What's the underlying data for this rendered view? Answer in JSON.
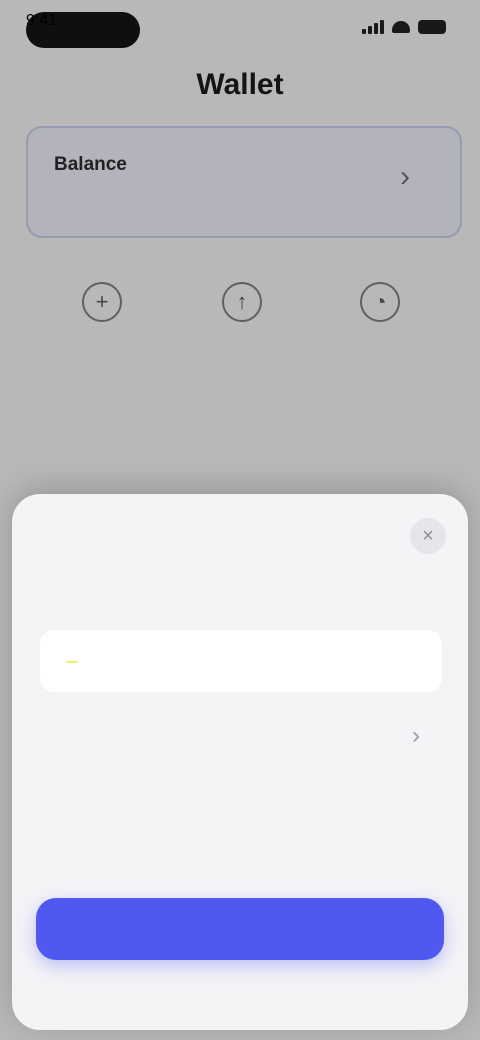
{
  "status_bar": {
    "time": "9:41"
  },
  "page": {
    "title": "Wallet"
  },
  "balance_card": {
    "title": "Balance",
    "subtitle": "",
    "arrow": "›"
  },
  "actions": [
    {
      "icon": "plus-icon",
      "glyph": "+",
      "label": ""
    },
    {
      "icon": "arrow-up-icon",
      "glyph": "↑",
      "label": ""
    },
    {
      "icon": "person-icon",
      "glyph": "◔",
      "label": ""
    }
  ],
  "sections": {
    "first": "",
    "second": ""
  },
  "sheet": {
    "title": "",
    "close_glyph": "×",
    "description": "",
    "description_link": "",
    "row_one": {
      "label": "",
      "highlight": "",
      "action": ""
    },
    "row_two": {
      "label": "",
      "chevron": "›"
    },
    "cta_label": ""
  },
  "colors": {
    "accent": "#4f59f0",
    "highlight": "#e9f07a",
    "card_border": "#c5cbea"
  }
}
